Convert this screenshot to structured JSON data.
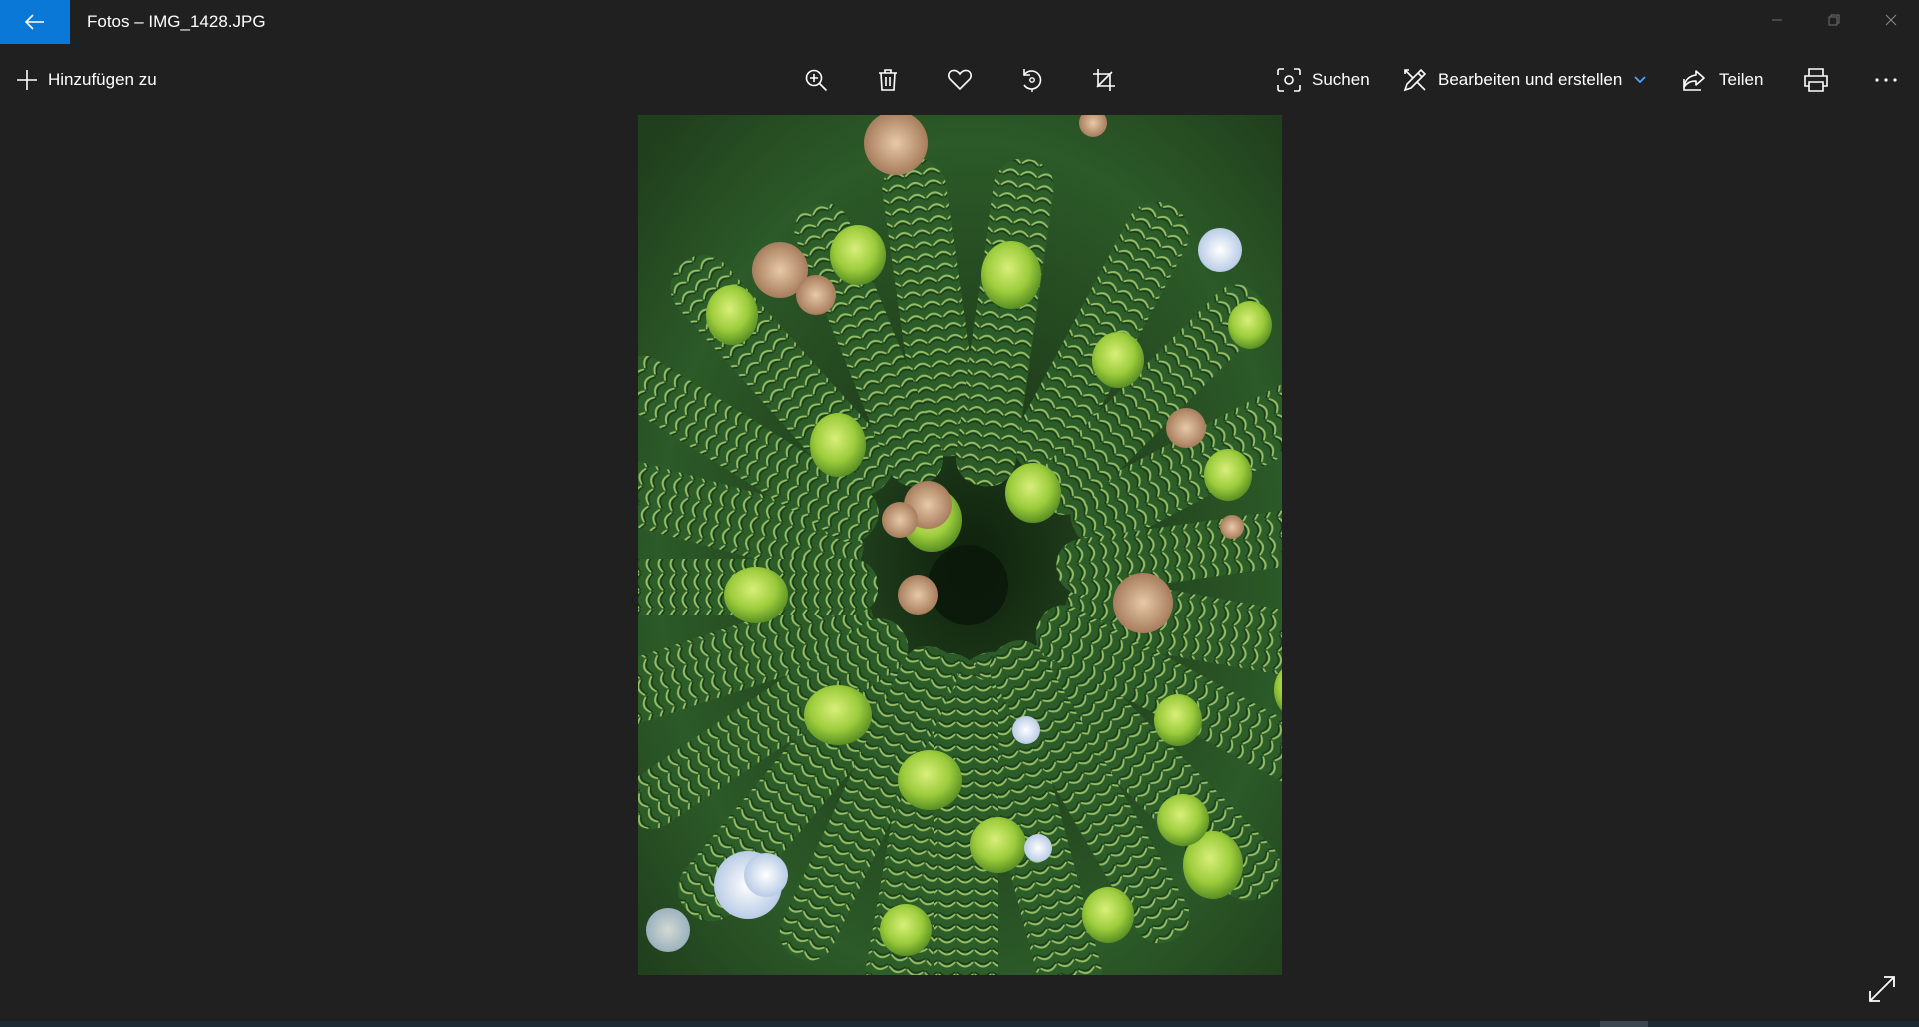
{
  "window": {
    "title": "Fotos – IMG_1428.JPG"
  },
  "toolbar": {
    "add_label": "Hinzufügen zu",
    "search_label": "Suchen",
    "edit_label": "Bearbeiten und erstellen",
    "share_label": "Teilen"
  },
  "icons": {
    "back": "arrow-left-icon",
    "add": "plus-icon",
    "zoom": "zoom-in-icon",
    "delete": "trash-icon",
    "favorite": "heart-icon",
    "rotate": "rotate-icon",
    "crop": "crop-icon",
    "search": "visual-search-icon",
    "edit": "edit-create-icon",
    "share": "share-icon",
    "print": "printer-icon",
    "more": "ellipsis-icon",
    "expand": "fullscreen-expand-icon"
  },
  "colors": {
    "accent": "#0a78d7",
    "background": "#202020",
    "chevron": "#4aa3ff"
  }
}
